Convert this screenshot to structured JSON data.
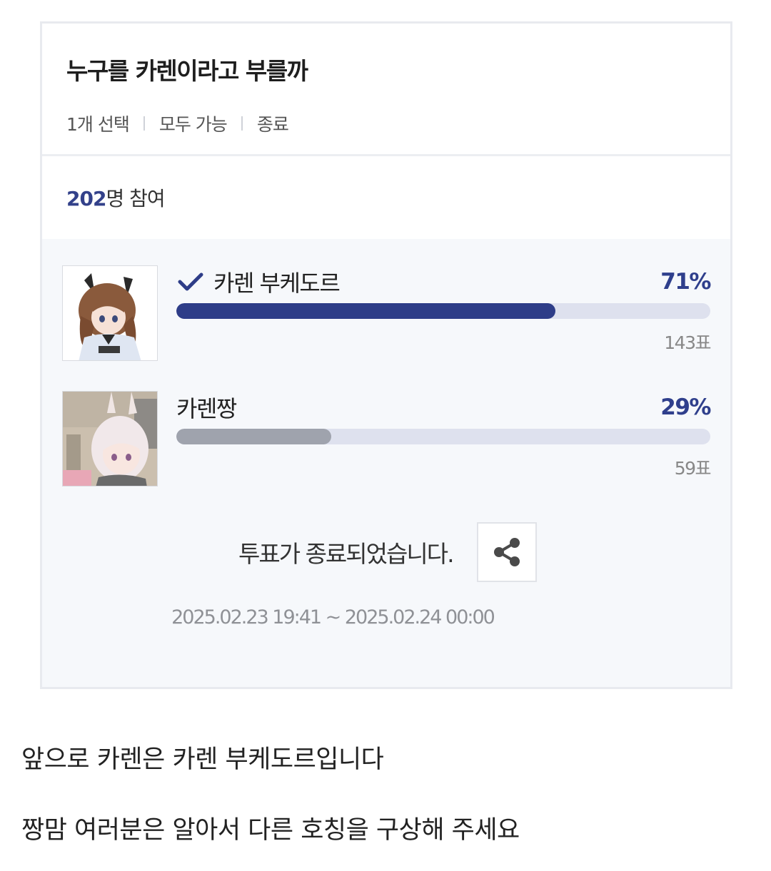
{
  "poll": {
    "title": "누구를 카렌이라고 부를까",
    "meta": [
      "1개 선택",
      "모두 가능",
      "종료"
    ],
    "participants_count": "202",
    "participants_suffix": "명 참여",
    "options": [
      {
        "label": "카렌 부케도르",
        "percent_text": "71%",
        "percent": 71,
        "votes": "143표",
        "selected": true,
        "bar_color": "#2e3d88"
      },
      {
        "label": "카렌짱",
        "percent_text": "29%",
        "percent": 29,
        "votes": "59표",
        "selected": false,
        "bar_color": "#9fa3ad"
      }
    ],
    "ended_text": "투표가 종료되었습니다.",
    "period": "2025.02.23 19:41 ~ 2025.02.24 00:00",
    "accent_color": "#2f3f8c"
  },
  "post": {
    "line1": "앞으로 카렌은 카렌 부케도르입니다",
    "line2": "짱맘 여러분은 알아서 다른 호칭을 구상해 주세요"
  },
  "icons": {
    "check": "check-icon",
    "share": "share-icon"
  }
}
